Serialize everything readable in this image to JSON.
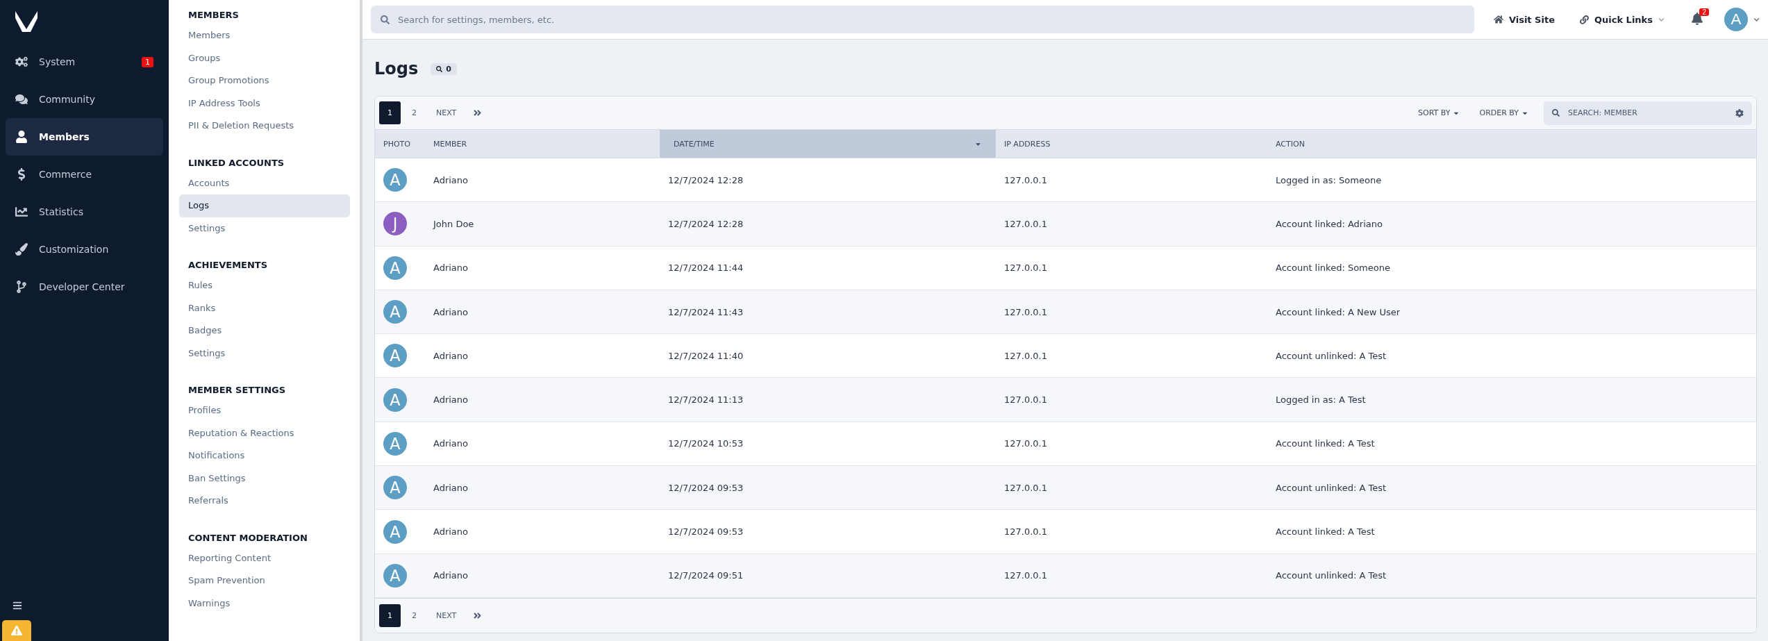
{
  "main_nav": [
    {
      "label": "System",
      "badge": "1",
      "selected": false
    },
    {
      "label": "Community",
      "selected": false
    },
    {
      "label": "Members",
      "selected": true
    },
    {
      "label": "Commerce",
      "selected": false
    },
    {
      "label": "Statistics",
      "selected": false
    },
    {
      "label": "Customization",
      "selected": false
    },
    {
      "label": "Developer Center",
      "selected": false
    }
  ],
  "sub_nav": [
    {
      "heading": "MEMBERS",
      "items": [
        {
          "label": "Members",
          "selected": false
        },
        {
          "label": "Groups",
          "selected": false
        },
        {
          "label": "Group Promotions",
          "selected": false
        },
        {
          "label": "IP Address Tools",
          "selected": false
        },
        {
          "label": "PII & Deletion Requests",
          "selected": false
        }
      ]
    },
    {
      "heading": "LINKED ACCOUNTS",
      "items": [
        {
          "label": "Accounts",
          "selected": false
        },
        {
          "label": "Logs",
          "selected": true
        },
        {
          "label": "Settings",
          "selected": false
        }
      ]
    },
    {
      "heading": "ACHIEVEMENTS",
      "items": [
        {
          "label": "Rules",
          "selected": false
        },
        {
          "label": "Ranks",
          "selected": false
        },
        {
          "label": "Badges",
          "selected": false
        },
        {
          "label": "Settings",
          "selected": false
        }
      ]
    },
    {
      "heading": "MEMBER SETTINGS",
      "items": [
        {
          "label": "Profiles",
          "selected": false
        },
        {
          "label": "Reputation & Reactions",
          "selected": false
        },
        {
          "label": "Notifications",
          "selected": false
        },
        {
          "label": "Ban Settings",
          "selected": false
        },
        {
          "label": "Referrals",
          "selected": false
        }
      ]
    },
    {
      "heading": "CONTENT MODERATION",
      "items": [
        {
          "label": "Reporting Content",
          "selected": false
        },
        {
          "label": "Spam Prevention",
          "selected": false
        },
        {
          "label": "Warnings",
          "selected": false
        }
      ]
    }
  ],
  "topbar": {
    "search_placeholder": "Search for settings, members, etc.",
    "visit_site": "Visit Site",
    "quick_links": "Quick Links",
    "notification_count": "2",
    "avatar_letter": "A"
  },
  "page": {
    "title": "Logs",
    "search_count": "0"
  },
  "pagination_top": {
    "pages": [
      {
        "label": "1",
        "selected": true
      },
      {
        "label": "2",
        "selected": false
      }
    ],
    "next": "NEXT"
  },
  "toolbar": {
    "sort_by": "SORT BY",
    "order_by": "ORDER BY",
    "search_placeholder": "SEARCH: MEMBER"
  },
  "table": {
    "columns": [
      {
        "label": "PHOTO",
        "sorted": false
      },
      {
        "label": "MEMBER",
        "sorted": false
      },
      {
        "label": "DATE/TIME",
        "sorted": true
      },
      {
        "label": "IP ADDRESS",
        "sorted": false
      },
      {
        "label": "ACTION",
        "sorted": false
      }
    ],
    "rows": [
      {
        "avatar_letter": "A",
        "color": "#5d9fc4",
        "member": "Adriano",
        "datetime": "12/7/2024 12:28",
        "ip": "127.0.0.1",
        "action": "Logged in as: Someone"
      },
      {
        "avatar_letter": "J",
        "color": "#8d5ec1",
        "member": "John Doe",
        "datetime": "12/7/2024 12:28",
        "ip": "127.0.0.1",
        "action": "Account linked: Adriano"
      },
      {
        "avatar_letter": "A",
        "color": "#5d9fc4",
        "member": "Adriano",
        "datetime": "12/7/2024 11:44",
        "ip": "127.0.0.1",
        "action": "Account linked: Someone"
      },
      {
        "avatar_letter": "A",
        "color": "#5d9fc4",
        "member": "Adriano",
        "datetime": "12/7/2024 11:43",
        "ip": "127.0.0.1",
        "action": "Account linked: A New User"
      },
      {
        "avatar_letter": "A",
        "color": "#5d9fc4",
        "member": "Adriano",
        "datetime": "12/7/2024 11:40",
        "ip": "127.0.0.1",
        "action": "Account unlinked: A Test"
      },
      {
        "avatar_letter": "A",
        "color": "#5d9fc4",
        "member": "Adriano",
        "datetime": "12/7/2024 11:13",
        "ip": "127.0.0.1",
        "action": "Logged in as: A Test"
      },
      {
        "avatar_letter": "A",
        "color": "#5d9fc4",
        "member": "Adriano",
        "datetime": "12/7/2024 10:53",
        "ip": "127.0.0.1",
        "action": "Account linked: A Test"
      },
      {
        "avatar_letter": "A",
        "color": "#5d9fc4",
        "member": "Adriano",
        "datetime": "12/7/2024 09:53",
        "ip": "127.0.0.1",
        "action": "Account unlinked: A Test"
      },
      {
        "avatar_letter": "A",
        "color": "#5d9fc4",
        "member": "Adriano",
        "datetime": "12/7/2024 09:53",
        "ip": "127.0.0.1",
        "action": "Account linked: A Test"
      },
      {
        "avatar_letter": "A",
        "color": "#5d9fc4",
        "member": "Adriano",
        "datetime": "12/7/2024 09:51",
        "ip": "127.0.0.1",
        "action": "Account unlinked: A Test"
      }
    ]
  },
  "pagination_bottom": {
    "pages": [
      {
        "label": "1",
        "selected": true
      },
      {
        "label": "2",
        "selected": false
      }
    ],
    "next": "NEXT"
  }
}
